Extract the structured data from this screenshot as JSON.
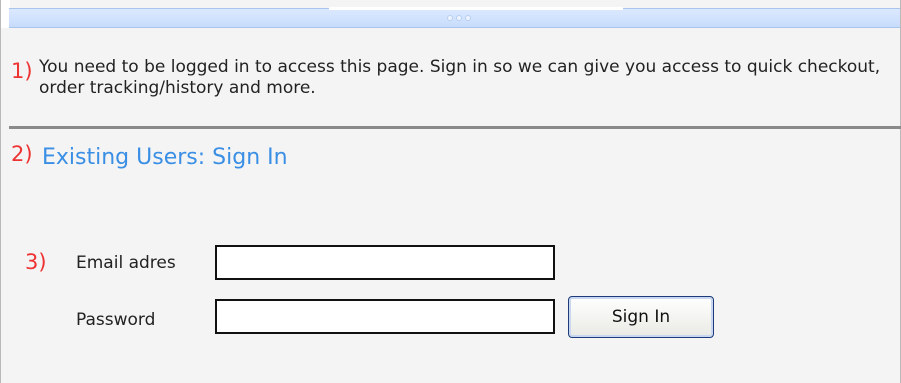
{
  "markers": {
    "one": "1)",
    "two": "2)",
    "three": "3)"
  },
  "intro_text": "You need to be logged in to access this page. Sign in so we can give you access to quick checkout, order tracking/history and more.",
  "section_title": "Existing Users: Sign In",
  "form": {
    "email_label": "Email adres",
    "email_value": "",
    "password_label": "Password",
    "password_value": "",
    "sign_in_label": "Sign In"
  },
  "colors": {
    "marker": "#ee3333",
    "title": "#3a8fe5",
    "top_bar": "#c7dcfb",
    "divider": "#8a8a8a"
  }
}
